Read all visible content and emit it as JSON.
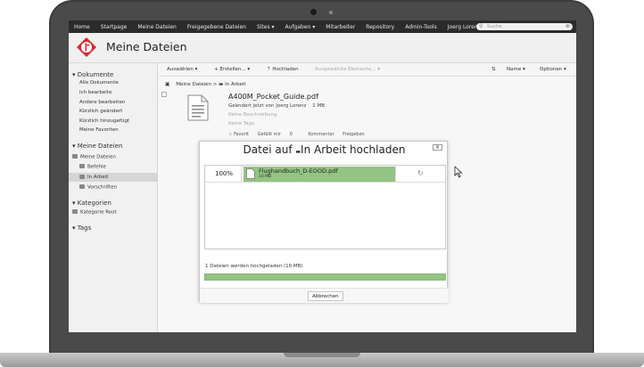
{
  "topnav": {
    "items": [
      "Home",
      "Startpage",
      "Meine Dateien",
      "Freigegebene Dateien",
      "Sites ▾",
      "Aufgaben ▾",
      "Mitarbeiter",
      "Repository",
      "Admin-Tools",
      "Joerg Lorenz ▾"
    ],
    "search_placeholder": "Suche"
  },
  "header": {
    "title": "Meine Dateien"
  },
  "sidebar": {
    "dokumente_head": "▾ Dokumente",
    "dokumente_links": [
      "Alle Dokumente",
      "Ich bearbeite",
      "Andere bearbeiten",
      "Kürzlich geändert",
      "Kürzlich hinzugefügt",
      "Meine Favoriten"
    ],
    "dateien_head": "▾ Meine Dateien",
    "root_folder": "Meine Dateien",
    "folders": [
      "Befehle",
      "In Arbeit",
      "Vorschriften"
    ],
    "kategorien_head": "▾ Kategorien",
    "kategorie_root": "Kategorie Root",
    "tags_head": "▾ Tags"
  },
  "toolbar": {
    "select": "Auswählen ▾",
    "create": "+ Erstellen... ▾",
    "upload": "⇡ Hochladen",
    "selected": "Ausgewählte Elemente... ▾",
    "sort_name": "Name ▾",
    "options": "Optionen ▾"
  },
  "breadcrumb": {
    "parent": "Meine Dateien",
    "separator": ">",
    "current": "In Arbeit"
  },
  "file": {
    "name": "A400M_Pocket_Guide.pdf",
    "modified": "Geändert jetzt von Joerg Lorenz",
    "size": "1 MB",
    "description": "Keine Beschreibung",
    "tags": "Keine Tags",
    "actions": [
      "☆ Favorit",
      "Gefällt mir",
      "0",
      "Kommentar",
      "Freigeben"
    ]
  },
  "dialog": {
    "title_prefix": "Datei auf",
    "title_folder": "In Arbeit hochladen",
    "close_label": "✕",
    "upload_percent": "100%",
    "upload_progress": 1.0,
    "upload_file_name": "Flughandbuch_D-EOOD.pdf",
    "upload_file_size": "10 MB",
    "status": "1 Dateien werden hochgeladen (10 MB)",
    "total_progress": 1.0,
    "cancel_label": "Abbrechen"
  },
  "colors": {
    "progress": "#93c482",
    "topnav": "#2b2b2b",
    "logo": "#d9282f"
  }
}
